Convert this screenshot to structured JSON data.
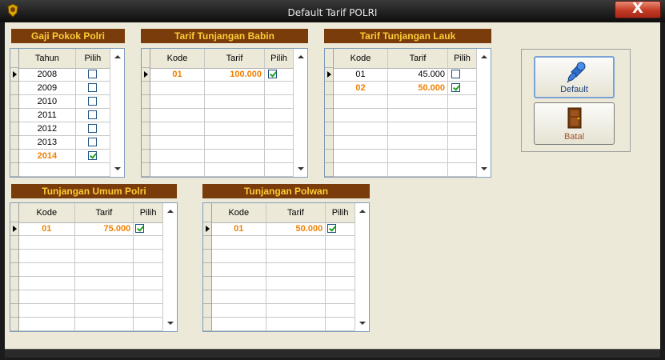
{
  "window": {
    "title": "Default Tarif POLRI",
    "close_symbol": "X"
  },
  "panels": {
    "gaji": {
      "title": "Gaji Pokok Polri",
      "columns": [
        "Tahun",
        "Pilih"
      ],
      "rows": [
        {
          "tahun": "2008",
          "pilih": false
        },
        {
          "tahun": "2009",
          "pilih": false
        },
        {
          "tahun": "2010",
          "pilih": false
        },
        {
          "tahun": "2011",
          "pilih": false
        },
        {
          "tahun": "2012",
          "pilih": false
        },
        {
          "tahun": "2013",
          "pilih": false
        },
        {
          "tahun": "2014",
          "pilih": true
        }
      ]
    },
    "babin": {
      "title": "Tarif Tunjangan Babin",
      "columns": [
        "Kode",
        "Tarif",
        "Pilih"
      ],
      "rows": [
        {
          "kode": "01",
          "tarif": "100.000",
          "pilih": true
        }
      ]
    },
    "lauk": {
      "title": "Tarif Tunjangan Lauk",
      "columns": [
        "Kode",
        "Tarif",
        "Pilih"
      ],
      "rows": [
        {
          "kode": "01",
          "tarif": "45.000",
          "pilih": false
        },
        {
          "kode": "02",
          "tarif": "50.000",
          "pilih": true
        }
      ]
    },
    "umum": {
      "title": "Tunjangan Umum Polri",
      "columns": [
        "Kode",
        "Tarif",
        "Pilih"
      ],
      "rows": [
        {
          "kode": "01",
          "tarif": "75.000",
          "pilih": true
        }
      ]
    },
    "polwan": {
      "title": "Tunjangan Polwan",
      "columns": [
        "Kode",
        "Tarif",
        "Pilih"
      ],
      "rows": [
        {
          "kode": "01",
          "tarif": "50.000",
          "pilih": true
        }
      ]
    }
  },
  "buttons": {
    "default_label": "Default",
    "batal_label": "Batal"
  },
  "colors": {
    "panel_title_bg": "#7a3c0b",
    "panel_title_fg": "#ffcc33",
    "selected_text": "#f08000",
    "checkmark": "#21a121"
  },
  "icons": {
    "app": "emblem-icon",
    "default": "pushpin-icon",
    "batal": "door-icon"
  }
}
